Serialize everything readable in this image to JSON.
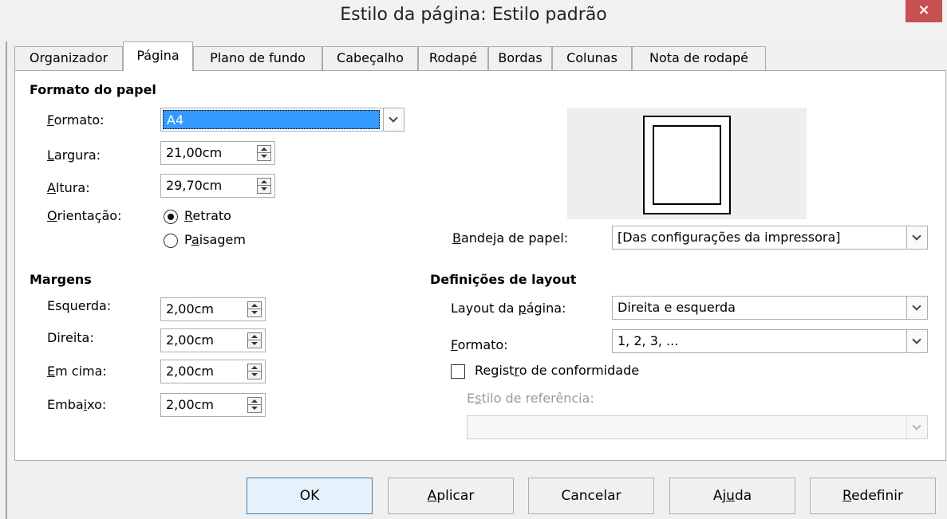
{
  "window": {
    "title": "Estilo da página: Estilo padrão",
    "close_label": "×"
  },
  "tabs": [
    {
      "label": "Organizador",
      "active": false
    },
    {
      "label": "Página",
      "active": true
    },
    {
      "label": "Plano de fundo",
      "active": false
    },
    {
      "label": "Cabeçalho",
      "active": false
    },
    {
      "label": "Rodapé",
      "active": false
    },
    {
      "label": "Bordas",
      "active": false
    },
    {
      "label": "Colunas",
      "active": false
    },
    {
      "label": "Nota de rodapé",
      "active": false
    }
  ],
  "paper_format": {
    "heading": "Formato do papel",
    "format": {
      "label_u": "F",
      "label_rest": "ormato:",
      "value": "A4"
    },
    "width": {
      "label_u": "L",
      "label_rest": "argura:",
      "value": "21,00cm"
    },
    "height": {
      "label_u": "A",
      "label_rest": "ltura:",
      "value": "29,70cm"
    },
    "orientation": {
      "label_u": "O",
      "label_rest": "rientação:",
      "portrait": {
        "label_u": "R",
        "label_rest": "etrato",
        "checked": true
      },
      "landscape": {
        "label_pre": "P",
        "label_u": "a",
        "label_rest": "isagem",
        "checked": false
      }
    },
    "paper_tray": {
      "label_u": "B",
      "label_rest": "andeja de papel:",
      "value": "[Das configurações da impressora]"
    }
  },
  "margins": {
    "heading": "Margens",
    "left": {
      "label": "Esquerda:",
      "value": "2,00cm"
    },
    "right": {
      "label": "Direita:",
      "value": "2,00cm"
    },
    "top": {
      "label_u": "E",
      "label_rest": "m cima:",
      "value": "2,00cm"
    },
    "bottom": {
      "label_pre": "Emba",
      "label_u": "i",
      "label_rest": "xo:",
      "value": "2,00cm"
    }
  },
  "layout_settings": {
    "heading": "Definições de layout",
    "page_layout": {
      "label_pre": "Layout da ",
      "label_u": "p",
      "label_rest": "ágina:",
      "value": "Direita e esquerda"
    },
    "format": {
      "label_u": "F",
      "label_rest": "ormato:",
      "value": "1, 2, 3, ..."
    },
    "register_true": {
      "label_pre": "Regist",
      "label_u": "r",
      "label_rest": "o de conformidade",
      "checked": false
    },
    "reference_style": {
      "label_pre": "E",
      "label_u": "s",
      "label_rest": "tilo de referência:",
      "value": ""
    }
  },
  "buttons": {
    "ok": "OK",
    "apply": {
      "label_u": "A",
      "label_rest": "plicar"
    },
    "cancel": "Cancelar",
    "help": {
      "label_pre": "Aj",
      "label_u": "u",
      "label_rest": "da"
    },
    "reset": {
      "label_u": "R",
      "label_rest": "edefinir"
    }
  },
  "colors": {
    "selection": "#3399ff",
    "close_button": "#c75050",
    "default_button_border": "#3c7fb1"
  }
}
